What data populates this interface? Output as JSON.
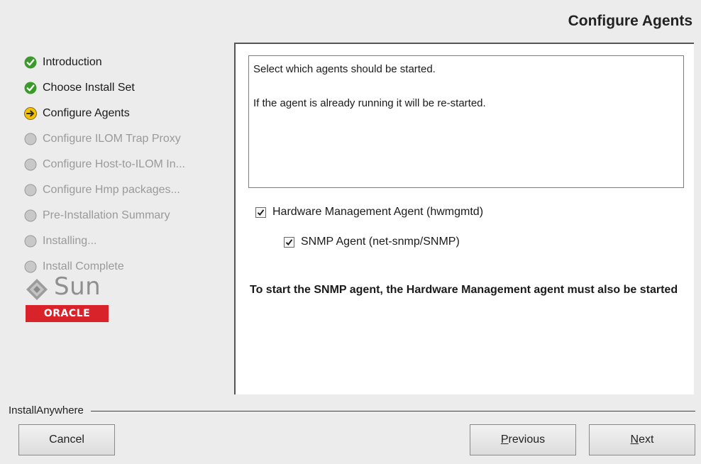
{
  "page_title": "Configure Agents",
  "steps": [
    {
      "label": "Introduction",
      "status": "done",
      "icon": "checkmark-icon"
    },
    {
      "label": "Choose Install Set",
      "status": "done",
      "icon": "checkmark-icon"
    },
    {
      "label": "Configure Agents",
      "status": "current",
      "icon": "arrow-right-icon"
    },
    {
      "label": "Configure ILOM Trap Proxy",
      "status": "pending",
      "icon": "circle-icon"
    },
    {
      "label": "Configure Host-to-ILOM In...",
      "status": "pending",
      "icon": "circle-icon"
    },
    {
      "label": "Configure Hmp packages...",
      "status": "pending",
      "icon": "circle-icon"
    },
    {
      "label": "Pre-Installation Summary",
      "status": "pending",
      "icon": "circle-icon"
    },
    {
      "label": "Installing...",
      "status": "pending",
      "icon": "circle-icon"
    },
    {
      "label": "Install Complete",
      "status": "pending",
      "icon": "circle-icon"
    }
  ],
  "logos": {
    "sun": "Sun",
    "oracle": "ORACLE"
  },
  "description": {
    "line1": "Select which agents should be started.",
    "line2": "If the agent is already running it will be re-started."
  },
  "options": {
    "hwmgmtd": {
      "label": "Hardware Management Agent (hwmgmtd)",
      "checked": true
    },
    "snmp": {
      "label": "SNMP Agent (net-snmp/SNMP)",
      "checked": true
    }
  },
  "note": "To start the SNMP agent, the Hardware Management agent must also be started",
  "footer": {
    "brand": "InstallAnywhere"
  },
  "buttons": {
    "cancel": "Cancel",
    "previous_mnemonic": "P",
    "previous_rest": "revious",
    "next_mnemonic": "N",
    "next_rest": "ext"
  },
  "colors": {
    "done": "#3a9a2a",
    "current": "#f2c200",
    "pending": "#b8b8b8",
    "oracle_red": "#d8232a"
  }
}
